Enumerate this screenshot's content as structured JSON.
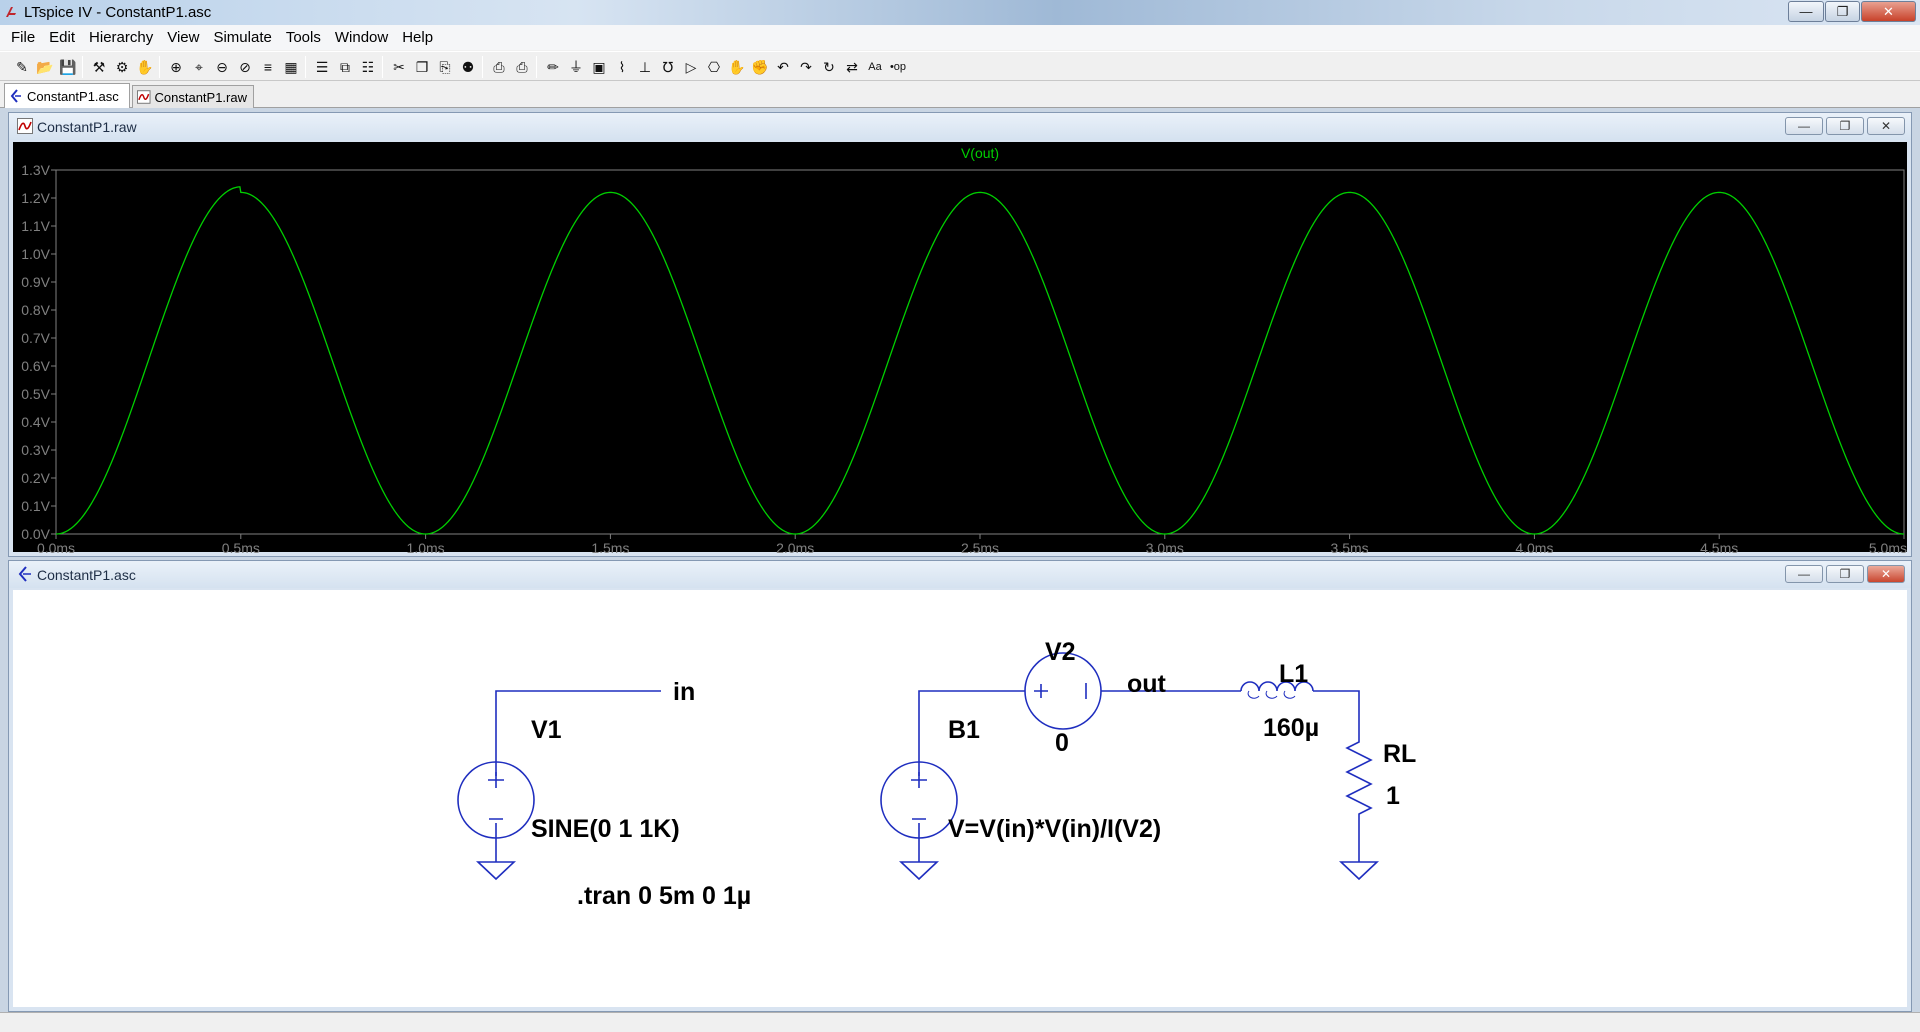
{
  "window": {
    "title": "LTspice IV - ConstantP1.asc"
  },
  "menu": [
    "File",
    "Edit",
    "Hierarchy",
    "View",
    "Simulate",
    "Tools",
    "Window",
    "Help"
  ],
  "toolbar_icons": [
    "new-schematic-icon",
    "open-icon",
    "save-icon",
    "control-panel-icon",
    "run-icon",
    "halt-icon",
    "zoom-in-icon",
    "zoom-pan-icon",
    "zoom-out-icon",
    "zoom-fit-icon",
    "autorange-icon",
    "grid-icon",
    "tile-horizontal-icon",
    "cascade-icon",
    "tile-vertical-icon",
    "cut-icon",
    "copy-icon",
    "paste-icon",
    "find-icon",
    "print-preview-icon",
    "print-icon",
    "draw-wire-icon",
    "ground-icon",
    "label-net-icon",
    "resistor-icon",
    "capacitor-icon",
    "inductor-icon",
    "diode-icon",
    "component-icon",
    "move-icon",
    "drag-icon",
    "undo-icon",
    "redo-icon",
    "rotate-icon",
    "mirror-icon",
    "text-icon",
    "spice-directive-icon"
  ],
  "tabs": [
    {
      "label": "ConstantP1.asc",
      "icon": "schematic-icon",
      "active": true
    },
    {
      "label": "ConstantP1.raw",
      "icon": "waveform-icon",
      "active": false
    }
  ],
  "waveform_window": {
    "title": "ConstantP1.raw"
  },
  "schematic_window": {
    "title": "ConstantP1.asc"
  },
  "chart_data": {
    "type": "line",
    "series": [
      {
        "name": "V(out)",
        "color": "#00d000",
        "note_peaks": [
          1.24,
          1.22,
          1.22,
          1.22,
          1.22,
          1.22,
          1.22,
          1.22,
          1.22,
          1.22
        ]
      }
    ],
    "x_ticks": [
      "0.0ms",
      "0.5ms",
      "1.0ms",
      "1.5ms",
      "2.0ms",
      "2.5ms",
      "3.0ms",
      "3.5ms",
      "4.0ms",
      "4.5ms",
      "5.0ms"
    ],
    "y_ticks": [
      "0.0V",
      "0.1V",
      "0.2V",
      "0.3V",
      "0.4V",
      "0.5V",
      "0.6V",
      "0.7V",
      "0.8V",
      "0.9V",
      "1.0V",
      "1.1V",
      "1.2V",
      "1.3V"
    ],
    "xlim": [
      0,
      5
    ],
    "ylim": [
      0,
      1.3
    ],
    "x_unit": "ms",
    "y_unit": "V",
    "frequency_khz": 1,
    "background": "#000000",
    "axis_color": "#808080",
    "text_color": "#808080"
  },
  "schematic": {
    "labels": {
      "net_in": "in",
      "net_out": "out",
      "v1_name": "V1",
      "v1_value": "SINE(0 1 1K)",
      "v2_name": "V2",
      "v2_value": "0",
      "b1_name": "B1",
      "b1_value": "V=V(in)*V(in)/I(V2)",
      "l1_name": "L1",
      "l1_value": "160µ",
      "rl_name": "RL",
      "rl_value": "1",
      "directive": ".tran 0 5m 0 1µ"
    },
    "wire_color": "#1f2ebf",
    "component_color": "#1f2ebf"
  }
}
